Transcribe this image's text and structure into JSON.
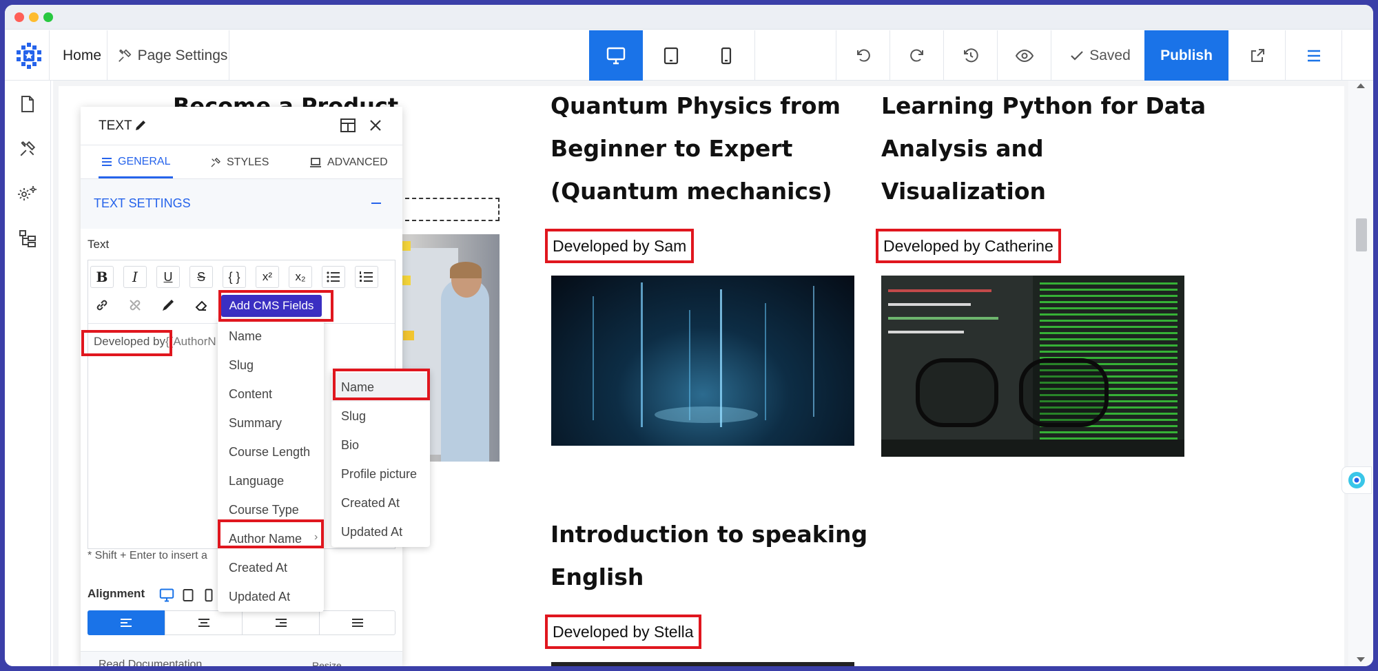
{
  "topbar": {
    "home": "Home",
    "page_settings": "Page Settings",
    "saved": "Saved",
    "publish": "Publish"
  },
  "content": {
    "course1": {
      "title_line1": "Become a Product",
      "developer": ""
    },
    "course2": {
      "title_lines": [
        "Quantum Physics from",
        "Beginner to Expert",
        "(Quantum mechanics)"
      ],
      "developer": "Developed by Sam"
    },
    "course3": {
      "title_lines": [
        "Learning Python for Data",
        "Analysis and",
        "Visualization"
      ],
      "developer": "Developed by Catherine"
    },
    "course4": {
      "title_lines": [
        "Introduction to speaking",
        "English"
      ],
      "developer": "Developed by Stella"
    }
  },
  "panel": {
    "title": "TEXT",
    "tabs": {
      "general": "GENERAL",
      "styles": "STYLES",
      "advanced": "ADVANCED"
    },
    "section_title": "TEXT SETTINGS",
    "text_label": "Text",
    "add_cms_fields": "Add CMS Fields",
    "editor_text": "Developed by",
    "editor_token": "{{AuthorN",
    "hint": "* Shift + Enter to insert a",
    "alignment_label": "Alignment",
    "read_documentation": "Read Documentation",
    "resize": "Resize"
  },
  "cms_menu": {
    "items": [
      "Name",
      "Slug",
      "Content",
      "Summary",
      "Course Length",
      "Language",
      "Course Type",
      "Author Name",
      "Created At",
      "Updated At"
    ],
    "submenu_items": [
      "Name",
      "Slug",
      "Bio",
      "Profile picture",
      "Created At",
      "Updated At"
    ]
  },
  "colors": {
    "accent": "#2563eb",
    "publish": "#1a73e8",
    "highlight": "#e0161e",
    "cms_button": "#3a2fc2"
  }
}
